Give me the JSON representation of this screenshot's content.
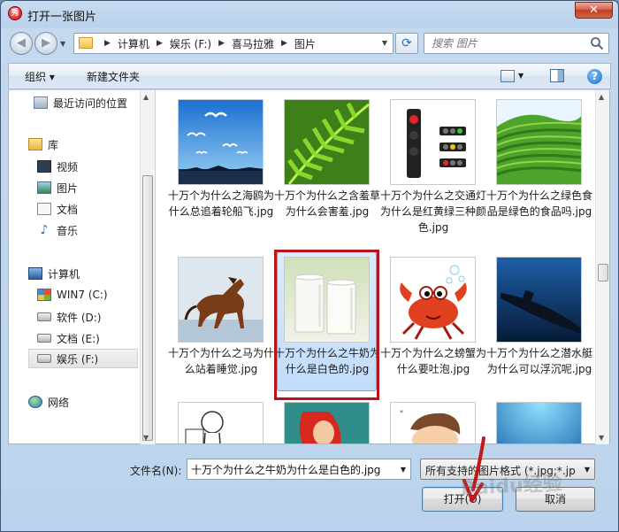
{
  "window": {
    "title": "打开一张图片",
    "close_label": "✕",
    "app_icon_glyph": "秀"
  },
  "nav": {
    "back_glyph": "◀",
    "forward_glyph": "▶"
  },
  "address": {
    "crumbs": [
      "计算机",
      "娱乐 (F:)",
      "喜马拉雅",
      "图片"
    ],
    "lead_sep": "▶"
  },
  "refresh_glyph": "⟳",
  "search": {
    "placeholder": "搜索 图片"
  },
  "toolbar": {
    "organize_label": "组织 ▾",
    "new_folder_label": "新建文件夹",
    "help_glyph": "?"
  },
  "sidebar": {
    "favorites": [
      {
        "label": "最近访问的位置",
        "icon": "recent-places-icon"
      }
    ],
    "libraries_header": "库",
    "libraries": [
      {
        "label": "视频",
        "icon": "video-icon"
      },
      {
        "label": "图片",
        "icon": "pictures-icon"
      },
      {
        "label": "文档",
        "icon": "documents-icon"
      },
      {
        "label": "音乐",
        "icon": "music-icon"
      }
    ],
    "computer_header": "计算机",
    "drives": [
      {
        "label": "WIN7 (C:)",
        "icon": "windows-drive-icon"
      },
      {
        "label": "软件 (D:)",
        "icon": "drive-icon"
      },
      {
        "label": "文档 (E:)",
        "icon": "drive-icon"
      },
      {
        "label": "娱乐 (F:)",
        "icon": "drive-icon",
        "selected": true
      }
    ],
    "network_header": "网络"
  },
  "files": [
    {
      "name": "十万个为什么之海鸥为什么总追着轮船飞.jpg",
      "thumb": "seagulls"
    },
    {
      "name": "十万个为什么之含羞草为什么会害羞.jpg",
      "thumb": "fern"
    },
    {
      "name": "十万个为什么之交通灯为什么是红黄绿三种颜色.jpg",
      "thumb": "traffic-light"
    },
    {
      "name": "十万个为什么之绿色食品是绿色的食品吗.jpg",
      "thumb": "tea-field"
    },
    {
      "name": "十万个为什么之马为什么站着睡觉.jpg",
      "thumb": "horse"
    },
    {
      "name": "十万个为什么之牛奶为什么是白色的.jpg",
      "thumb": "milk",
      "selected": true
    },
    {
      "name": "十万个为什么之螃蟹为什么要吐泡.jpg",
      "thumb": "crab"
    },
    {
      "name": "十万个为什么之潜水艇为什么可以浮沉呢.jpg",
      "thumb": "submarine"
    },
    {
      "name": "",
      "thumb": "cartoon-man"
    },
    {
      "name": "",
      "thumb": "mermaid"
    },
    {
      "name": "",
      "thumb": "cartoon-kid"
    },
    {
      "name": "",
      "thumb": "sea"
    }
  ],
  "bottom": {
    "filename_label": "文件名(N):",
    "filename_value": "十万个为什么之牛奶为什么是白色的.jpg",
    "filetype_value": "所有支持的图片格式 (*.jpg;*.jp",
    "open_label": "打开(O)",
    "cancel_label": "取消"
  },
  "watermark": "Baidu经验"
}
